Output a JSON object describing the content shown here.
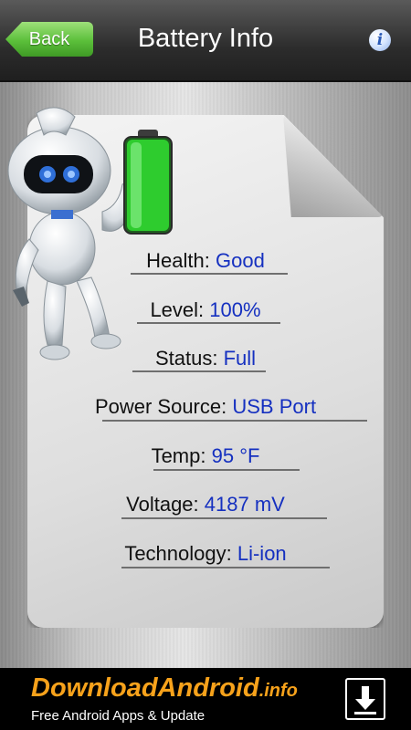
{
  "header": {
    "back_label": "Back",
    "title": "Battery Info",
    "info_icon": "info-icon"
  },
  "battery": {
    "level_fraction": 1.0,
    "color": "#2ecc2e"
  },
  "rows": [
    {
      "label": "Health:",
      "value": "Good"
    },
    {
      "label": "Level:",
      "value": "100%"
    },
    {
      "label": "Status:",
      "value": "Full"
    },
    {
      "label": "Power Source:",
      "value": "USB Port"
    },
    {
      "label": "Temp:",
      "value": "95 °F"
    },
    {
      "label": "Voltage:",
      "value": "4187 mV"
    },
    {
      "label": "Technology:",
      "value": "Li-ion"
    }
  ],
  "ad": {
    "brand": "DownloadAndroid",
    "brand_suffix": ".info",
    "subtitle": "Free Android Apps & Update",
    "brand_color": "#f7a21b"
  },
  "colors": {
    "value_text": "#1530c0",
    "back_button": "#5bbf3a"
  }
}
